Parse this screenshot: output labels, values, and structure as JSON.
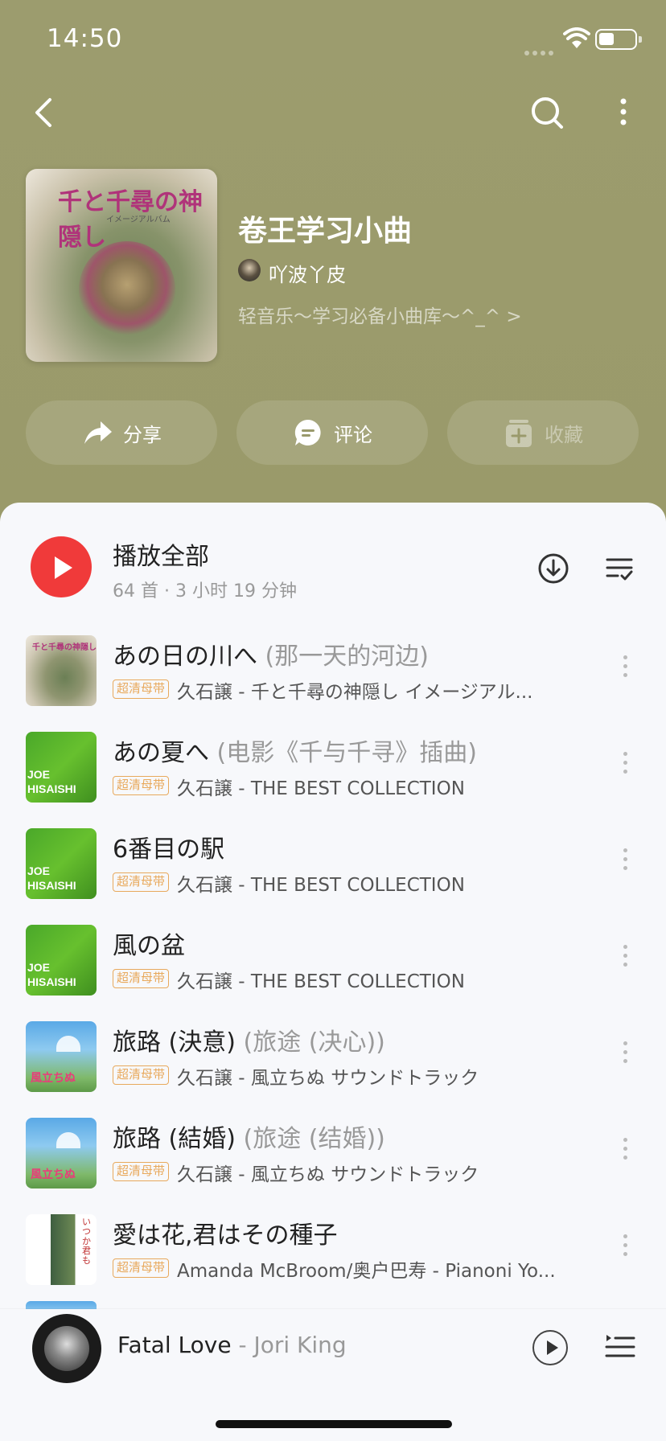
{
  "status_bar": {
    "time": "14:50"
  },
  "nav": {
    "back_icon": "chevron-left-icon",
    "search_icon": "search-icon",
    "more_icon": "more-vertical-icon"
  },
  "playlist": {
    "title": "卷王学习小曲",
    "author": "吖波丫皮",
    "description": "轻音乐～学习必备小曲库～^_^ >",
    "cover_title": "千と千尋の神隠し",
    "cover_subtitle": "イメージアルバム"
  },
  "actions": {
    "share_label": "分享",
    "comment_label": "评论",
    "collect_label": "收藏"
  },
  "play_all": {
    "label": "播放全部",
    "meta": "64 首 · 3 小时 19 分钟"
  },
  "songs": [
    {
      "title": "あの日の川へ",
      "alias": "(那一天的河边)",
      "badge": "超清母带",
      "subtitle": "久石譲 - 千と千尋の神隠し イメージアル..."
    },
    {
      "title": "あの夏へ",
      "alias": "(电影《千与千寻》插曲)",
      "badge": "超清母带",
      "subtitle": "久石譲 - THE BEST COLLECTION"
    },
    {
      "title": "6番目の駅",
      "alias": "",
      "badge": "超清母带",
      "subtitle": "久石譲 - THE BEST COLLECTION"
    },
    {
      "title": "風の盆",
      "alias": "",
      "badge": "超清母带",
      "subtitle": "久石譲 - THE BEST COLLECTION"
    },
    {
      "title": "旅路 (決意)",
      "alias": "(旅途 (决心))",
      "badge": "超清母带",
      "subtitle": "久石譲 - 風立ちぬ サウンドトラック"
    },
    {
      "title": "旅路 (結婚)",
      "alias": "(旅途 (结婚))",
      "badge": "超清母带",
      "subtitle": "久石譲 - 風立ちぬ サウンドトラック"
    },
    {
      "title": "愛は花,君はその種子",
      "alias": "",
      "badge": "超清母带",
      "subtitle": "Amanda McBroom/奥户巴寿 - Pianoni Yo..."
    }
  ],
  "art_text": {
    "joe": "JOE HISAISHI",
    "wind": "風立ちぬ",
    "love": "いつか君も"
  },
  "mini_player": {
    "title": "Fatal Love",
    "separator": " - ",
    "artist": "Jori King"
  },
  "colors": {
    "accent": "#f03a3a",
    "header_bg": "#9a9a6c",
    "badge": "#e8a95c"
  }
}
